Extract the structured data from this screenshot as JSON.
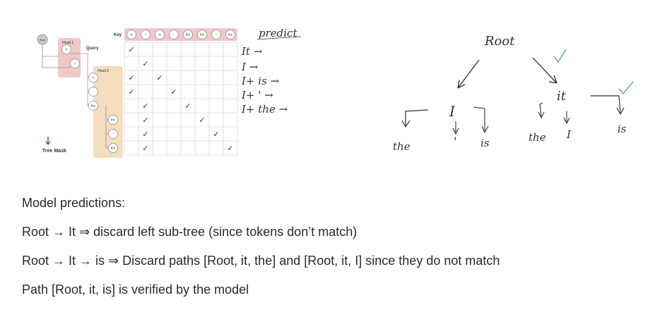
{
  "figure": {
    "root_label": "Root",
    "key_label": "Key",
    "query_label": "Query",
    "head1_label": "Head 1",
    "head2_label": "Head 2",
    "tree_mask_label": "Tree Mask",
    "query_tokens": [
      "It",
      "I",
      "is",
      "'",
      "the",
      "the",
      "'",
      "the"
    ],
    "key_tokens": [
      "It",
      "I",
      "is",
      "'",
      "the",
      "the",
      "'",
      "the"
    ],
    "mask_checks": [
      [
        1,
        0,
        0,
        0,
        0,
        0,
        0,
        0
      ],
      [
        0,
        1,
        0,
        0,
        0,
        0,
        0,
        0
      ],
      [
        1,
        0,
        1,
        0,
        0,
        0,
        0,
        0
      ],
      [
        1,
        0,
        0,
        1,
        0,
        0,
        0,
        0
      ],
      [
        0,
        1,
        0,
        0,
        1,
        0,
        0,
        0
      ],
      [
        0,
        1,
        0,
        0,
        0,
        1,
        0,
        0
      ],
      [
        0,
        1,
        0,
        0,
        0,
        0,
        1,
        0
      ],
      [
        0,
        1,
        0,
        0,
        0,
        0,
        0,
        1
      ]
    ],
    "check_glyph": "✓"
  },
  "notes": {
    "header": "predict",
    "lines": [
      "It →",
      "I →",
      "I+ is →",
      "I+ ' →",
      "I+ the →"
    ]
  },
  "tree": {
    "root": "Root",
    "mid_left": "I",
    "mid_right": "it",
    "leaves": [
      "the",
      "'",
      "is",
      "the",
      "I",
      "is"
    ],
    "check_glyph": "✓",
    "check_color": "#6aa86a"
  },
  "predictions": {
    "heading": "Model predictions:",
    "lines": [
      "Root → It ⇒ discard left sub-tree (since tokens don’t match)",
      "Root → It → is ⇒ Discard paths [Root, it, the] and [Root, it, I] since they do not match",
      "Path [Root, it, is] is verified by the model"
    ]
  },
  "colors": {
    "head1_fill": "#f0c8c8",
    "head2_fill": "#f3dcc0",
    "key_header_fill": "#f0c8c8",
    "grid_line": "#cccccc",
    "check": "#2a2f7a",
    "arrow_green": "#3d8a4a"
  }
}
